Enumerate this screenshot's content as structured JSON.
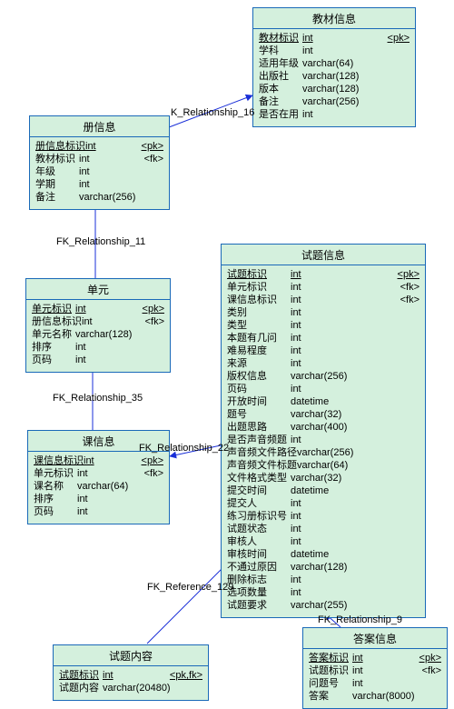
{
  "chart_data": {
    "type": "table",
    "title": "ER Diagram (Physical Data Model)",
    "entities": [
      {
        "name": "教材信息",
        "columns": [
          {
            "name": "教材标识",
            "type": "int",
            "key": "<pk>",
            "underline": true,
            "type_underline": true
          },
          {
            "name": "学科",
            "type": "int"
          },
          {
            "name": "适用年级",
            "type": "varchar(64)"
          },
          {
            "name": "出版社",
            "type": "varchar(128)"
          },
          {
            "name": "版本",
            "type": "varchar(128)"
          },
          {
            "name": "备注",
            "type": "varchar(256)"
          },
          {
            "name": "是否在用",
            "type": "int"
          }
        ]
      },
      {
        "name": "册信息",
        "columns": [
          {
            "name": "册信息标识",
            "type": "int",
            "key": "<pk>",
            "underline": true,
            "type_underline": true
          },
          {
            "name": "教材标识",
            "type": "int",
            "key": "<fk>"
          },
          {
            "name": "年级",
            "type": "int"
          },
          {
            "name": "学期",
            "type": "int"
          },
          {
            "name": "备注",
            "type": "varchar(256)"
          }
        ]
      },
      {
        "name": "单元",
        "columns": [
          {
            "name": "单元标识",
            "type": "int",
            "key": "<pk>",
            "underline": true,
            "type_underline": true
          },
          {
            "name": "册信息标识",
            "type": "int",
            "key": "<fk>"
          },
          {
            "name": "单元名称",
            "type": "varchar(128)"
          },
          {
            "name": "排序",
            "type": "int"
          },
          {
            "name": "页码",
            "type": "int"
          }
        ]
      },
      {
        "name": "课信息",
        "columns": [
          {
            "name": "课信息标识",
            "type": "int",
            "key": "<pk>",
            "underline": true,
            "type_underline": true
          },
          {
            "name": "单元标识",
            "type": "int",
            "key": "<fk>"
          },
          {
            "name": "课名称",
            "type": "varchar(64)"
          },
          {
            "name": "排序",
            "type": "int"
          },
          {
            "name": "页码",
            "type": "int"
          }
        ]
      },
      {
        "name": "试题信息",
        "wide": true,
        "columns": [
          {
            "name": "试题标识",
            "type": "int",
            "key": "<pk>",
            "underline": true,
            "type_underline": true
          },
          {
            "name": "单元标识",
            "type": "int",
            "key": "<fk>"
          },
          {
            "name": "课信息标识",
            "type": "int",
            "key": "<fk>"
          },
          {
            "name": "类别",
            "type": "int"
          },
          {
            "name": "类型",
            "type": "int"
          },
          {
            "name": "本题有几问",
            "type": "int"
          },
          {
            "name": "难易程度",
            "type": "int"
          },
          {
            "name": "来源",
            "type": "int"
          },
          {
            "name": "版权信息",
            "type": "varchar(256)"
          },
          {
            "name": "页码",
            "type": "int"
          },
          {
            "name": "开放时间",
            "type": "datetime"
          },
          {
            "name": "题号",
            "type": "varchar(32)"
          },
          {
            "name": "出题思路",
            "type": "varchar(400)"
          },
          {
            "name": "是否声音频题",
            "type": "int"
          },
          {
            "name": "声音频文件路径",
            "type": "varchar(256)"
          },
          {
            "name": "声音频文件标题",
            "type": "varchar(64)"
          },
          {
            "name": "文件格式类型",
            "type": "varchar(32)"
          },
          {
            "name": "提交时间",
            "type": "datetime"
          },
          {
            "name": "提交人",
            "type": "int"
          },
          {
            "name": "练习册标识号",
            "type": "int"
          },
          {
            "name": "试题状态",
            "type": "int"
          },
          {
            "name": "审核人",
            "type": "int"
          },
          {
            "name": "审核时间",
            "type": "datetime"
          },
          {
            "name": "不通过原因",
            "type": "varchar(128)"
          },
          {
            "name": "删除标志",
            "type": "int"
          },
          {
            "name": "选项数量",
            "type": "int"
          },
          {
            "name": "试题要求",
            "type": "varchar(255)"
          }
        ]
      },
      {
        "name": "试题内容",
        "columns": [
          {
            "name": "试题标识",
            "type": "int",
            "key": "<pk,fk>",
            "underline": true,
            "type_underline": true
          },
          {
            "name": "试题内容",
            "type": "varchar(20480)"
          }
        ]
      },
      {
        "name": "答案信息",
        "columns": [
          {
            "name": "答案标识",
            "type": "int",
            "key": "<pk>",
            "underline": true,
            "type_underline": true
          },
          {
            "name": "试题标识",
            "type": "int",
            "key": "<fk>"
          },
          {
            "name": "问题号",
            "type": "int"
          },
          {
            "name": "答案",
            "type": "varchar(8000)"
          }
        ]
      }
    ],
    "relationships": [
      {
        "label": "K_Relationship_16"
      },
      {
        "label": "FK_Relationship_11"
      },
      {
        "label": "FK_Relationship_35"
      },
      {
        "label": "FK_Relationship_22"
      },
      {
        "label": "FK_Reference_129"
      },
      {
        "label": "FK_Relationship_9"
      }
    ]
  }
}
